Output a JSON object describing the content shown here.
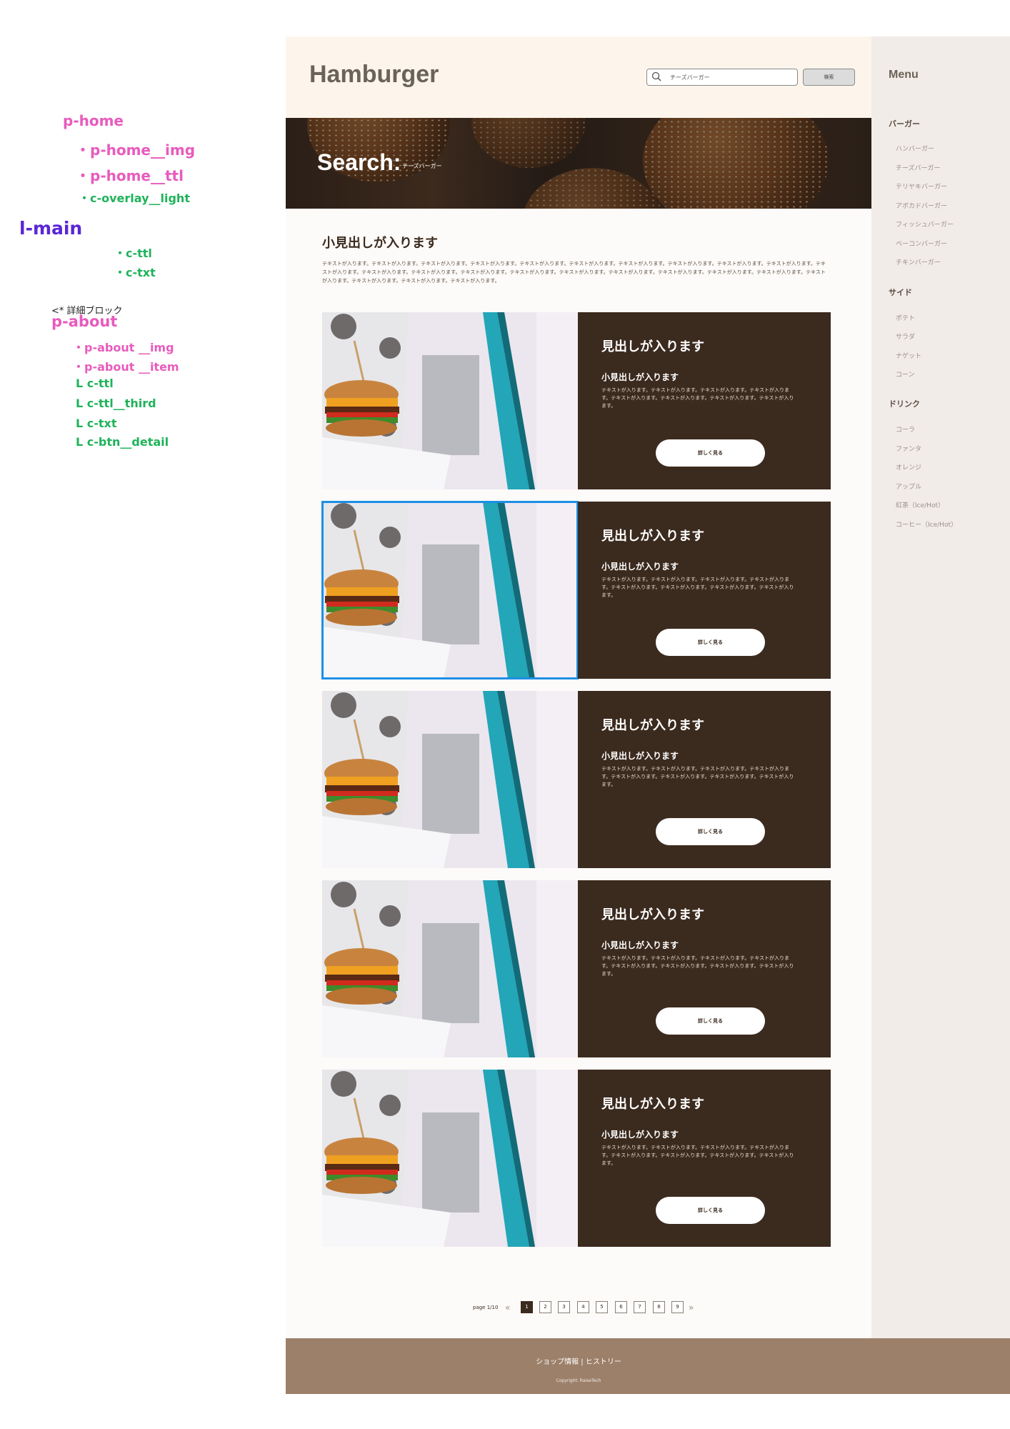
{
  "annotations": {
    "p_home": "p-home",
    "p_home_img": "・p-home__img",
    "p_home_ttl": "・p-home__ttl",
    "c_overlay_light": "・c-overlay__light",
    "l_main": "l-main",
    "c_ttl": "・c-ttl",
    "c_txt": "・c-txt",
    "detail_block": "<* 詳細ブロック",
    "p_about": "p-about",
    "p_about_img": "・p-about __img",
    "p_about_item": "・p-about __item",
    "l_c_ttl": "L  c-ttl",
    "l_c_ttl_third": "L  c-ttl__third",
    "l_c_txt": "L  c-txt",
    "l_c_btn_detail": "L  c-btn__detail"
  },
  "header": {
    "logo": "Hamburger",
    "search_value": "チーズバーガー",
    "search_button": "検索",
    "search_icon": "search-icon"
  },
  "hero": {
    "title": "Search:",
    "query": "チーズバーガー"
  },
  "intro": {
    "title": "小見出しが入ります",
    "text": "テキストが入ります。テキストが入ります。テキストが入ります。テキストが入ります。テキストが入ります。テキストが入ります。テキストが入ります。テキストが入ります。テキストが入ります。テキストが入ります。テキストが入ります。テキストが入ります。テキストが入ります。テキストが入ります。テキストが入ります。テキストが入ります。テキストが入ります。テキストが入ります。テキストが入ります。テキストが入ります。テキストが入ります。テキストが入ります。テキストが入ります。テキストが入ります。"
  },
  "cards": [
    {
      "heading": "見出しが入ります",
      "subheading": "小見出しが入ります",
      "text": "テキストが入ります。テキストが入ります。テキストが入ります。テキストが入ります。テキストが入ります。テキストが入ります。テキストが入ります。テキストが入ります。",
      "button": "詳しく見る"
    },
    {
      "heading": "見出しが入ります",
      "subheading": "小見出しが入ります",
      "text": "テキストが入ります。テキストが入ります。テキストが入ります。テキストが入ります。テキストが入ります。テキストが入ります。テキストが入ります。テキストが入ります。",
      "button": "詳しく見る"
    },
    {
      "heading": "見出しが入ります",
      "subheading": "小見出しが入ります",
      "text": "テキストが入ります。テキストが入ります。テキストが入ります。テキストが入ります。テキストが入ります。テキストが入ります。テキストが入ります。テキストが入ります。",
      "button": "詳しく見る"
    },
    {
      "heading": "見出しが入ります",
      "subheading": "小見出しが入ります",
      "text": "テキストが入ります。テキストが入ります。テキストが入ります。テキストが入ります。テキストが入ります。テキストが入ります。テキストが入ります。テキストが入ります。",
      "button": "詳しく見る"
    },
    {
      "heading": "見出しが入ります",
      "subheading": "小見出しが入ります",
      "text": "テキストが入ります。テキストが入ります。テキストが入ります。テキストが入ります。テキストが入ります。テキストが入ります。テキストが入ります。テキストが入ります。",
      "button": "詳しく見る"
    }
  ],
  "pagination": {
    "label": "page 1/10",
    "prev": "«",
    "next": "»",
    "pages": [
      "1",
      "2",
      "3",
      "4",
      "5",
      "6",
      "7",
      "8",
      "9"
    ],
    "current": "1"
  },
  "footer": {
    "links": "ショップ情報 | ヒストリー",
    "copyright": "Copyright: RaiseTech"
  },
  "sidebar": {
    "title": "Menu",
    "categories": [
      {
        "name": "バーガー",
        "items": [
          "ハンバーガー",
          "チーズバーガー",
          "テリヤキバーガー",
          "アボカドバーガー",
          "フィッシュバーガー",
          "ベーコンバーガー",
          "チキンバーガー"
        ]
      },
      {
        "name": "サイド",
        "items": [
          "ポテト",
          "サラダ",
          "ナゲット",
          "コーン"
        ]
      },
      {
        "name": "ドリンク",
        "items": [
          "コーラ",
          "ファンタ",
          "オレンジ",
          "アップル",
          "紅茶（Ice/Hot）",
          "コーヒー（Ice/Hot）"
        ]
      }
    ]
  },
  "colors": {
    "brand_brown": "#3b2a1e",
    "header_bg": "#fdf5ec",
    "sidebar_bg": "#f1ece8",
    "footer_bg": "#9c806a",
    "selection_blue": "#1e8fe6",
    "annotation_pink": "#e85bbd",
    "annotation_green": "#1fb35a",
    "annotation_purple": "#5a26d6"
  }
}
